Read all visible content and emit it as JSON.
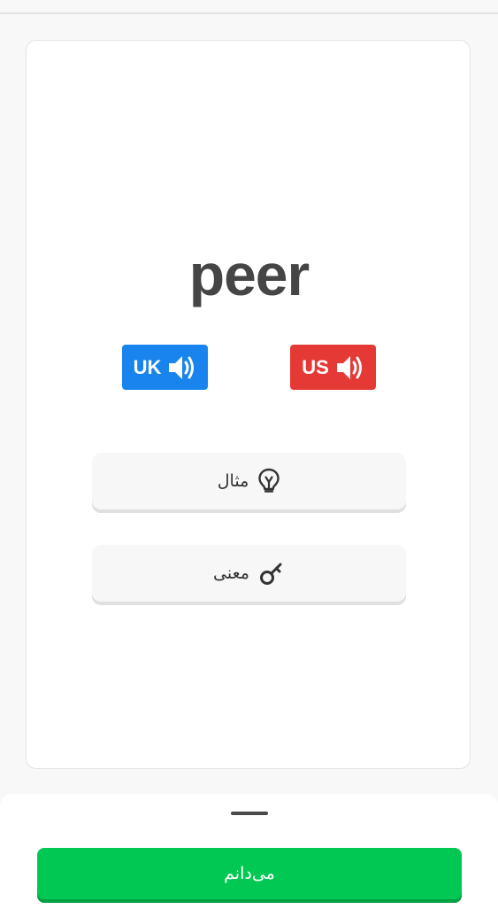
{
  "card": {
    "word": "peer"
  },
  "pronunciation": {
    "uk_label": "UK",
    "us_label": "US",
    "uk_color": "#1a84ee",
    "us_color": "#e53935",
    "icon": "speaker-icon"
  },
  "actions": {
    "example_label": "مثال",
    "example_icon": "lightbulb-icon",
    "meaning_label": "معنی",
    "meaning_icon": "key-icon"
  },
  "bottom": {
    "know_label": "می‌دانم",
    "know_color": "#00c853"
  }
}
